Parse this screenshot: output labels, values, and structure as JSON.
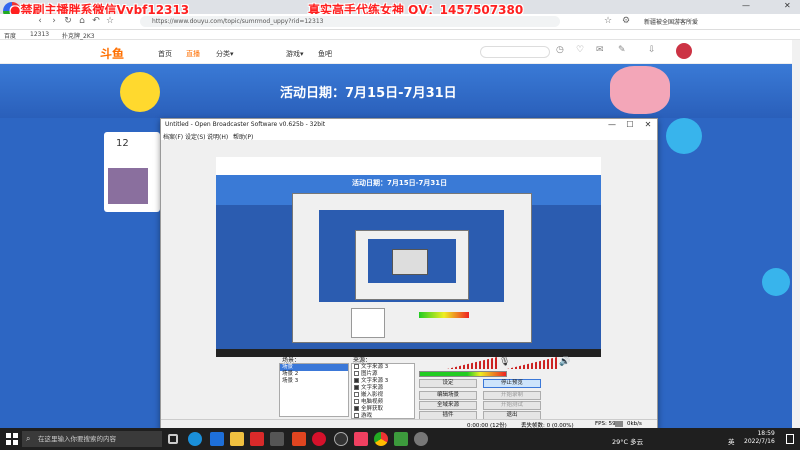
{
  "overlays": {
    "left": "●禁刷主播胖系微信Vybf12313",
    "right": "真实高手代练女神 QV：1457507380"
  },
  "browser": {
    "tab1": "QQ",
    "tab2": "12313",
    "url": "https://www.douyu.com/topic/sumrmod_uppy?rid=12313",
    "bookmarks": [
      "百度",
      "12313",
      "扑克牌_2K3"
    ],
    "right_text": "新疆被全国游客所爱"
  },
  "douyu": {
    "logo": "斗鱼",
    "nav": [
      "首页",
      "直播",
      "分类▾",
      "游戏▾",
      "鱼吧"
    ],
    "header_icons": [
      "历史",
      "关注",
      "消息",
      "创作中心",
      "下载"
    ],
    "event_date": "活动日期：7月15日-7月31日",
    "side_number": "12"
  },
  "obs": {
    "title": "Untitled - Open Broadcaster Software v0.625b - 32bit",
    "menu": [
      "档案(F)",
      "设定(S)",
      "说明(H)",
      "帮助(P)"
    ],
    "preview_event_date": "活动日期：7月15日-7月31日",
    "scenes_label": "场景：",
    "scenes": [
      "场景",
      "场景 2",
      "场景 3"
    ],
    "sources_label": "来源：",
    "sources": [
      {
        "label": "文字来源 3",
        "checked": false
      },
      {
        "label": "图片源",
        "checked": false
      },
      {
        "label": "文字来源 3",
        "checked": true
      },
      {
        "label": "文字来源",
        "checked": true
      },
      {
        "label": "嵌入影视",
        "checked": false
      },
      {
        "label": "电脑视频",
        "checked": false
      },
      {
        "label": "全屏获取",
        "checked": true
      },
      {
        "label": "游戏",
        "checked": false
      }
    ],
    "buttons": {
      "settings": "设定",
      "stop_preview": "停止预览",
      "edit_scene": "编辑场景",
      "start_record": "开始录制",
      "global_sources": "全域来源",
      "unknown": "开始测试",
      "plugins": "插件",
      "exit": "退出"
    },
    "status": {
      "time": "0:00:00 (12份)",
      "dropped": "丢失帧数: 0 (0.00%)",
      "fps": "FPS: 59",
      "bitrate": "0kb/s"
    }
  },
  "taskbar": {
    "search_placeholder": "在这里输入你要搜索的内容",
    "weather": "29°C 多云",
    "time": "18:59",
    "date": "2022/7/16",
    "ime": "英"
  },
  "colors": {
    "overlay_left": "#ff2020",
    "overlay_right": "#ff2020",
    "douyu_orange": "#ff6f00",
    "banner_blue": "#2a5fba",
    "selected": "#3b78d8"
  }
}
